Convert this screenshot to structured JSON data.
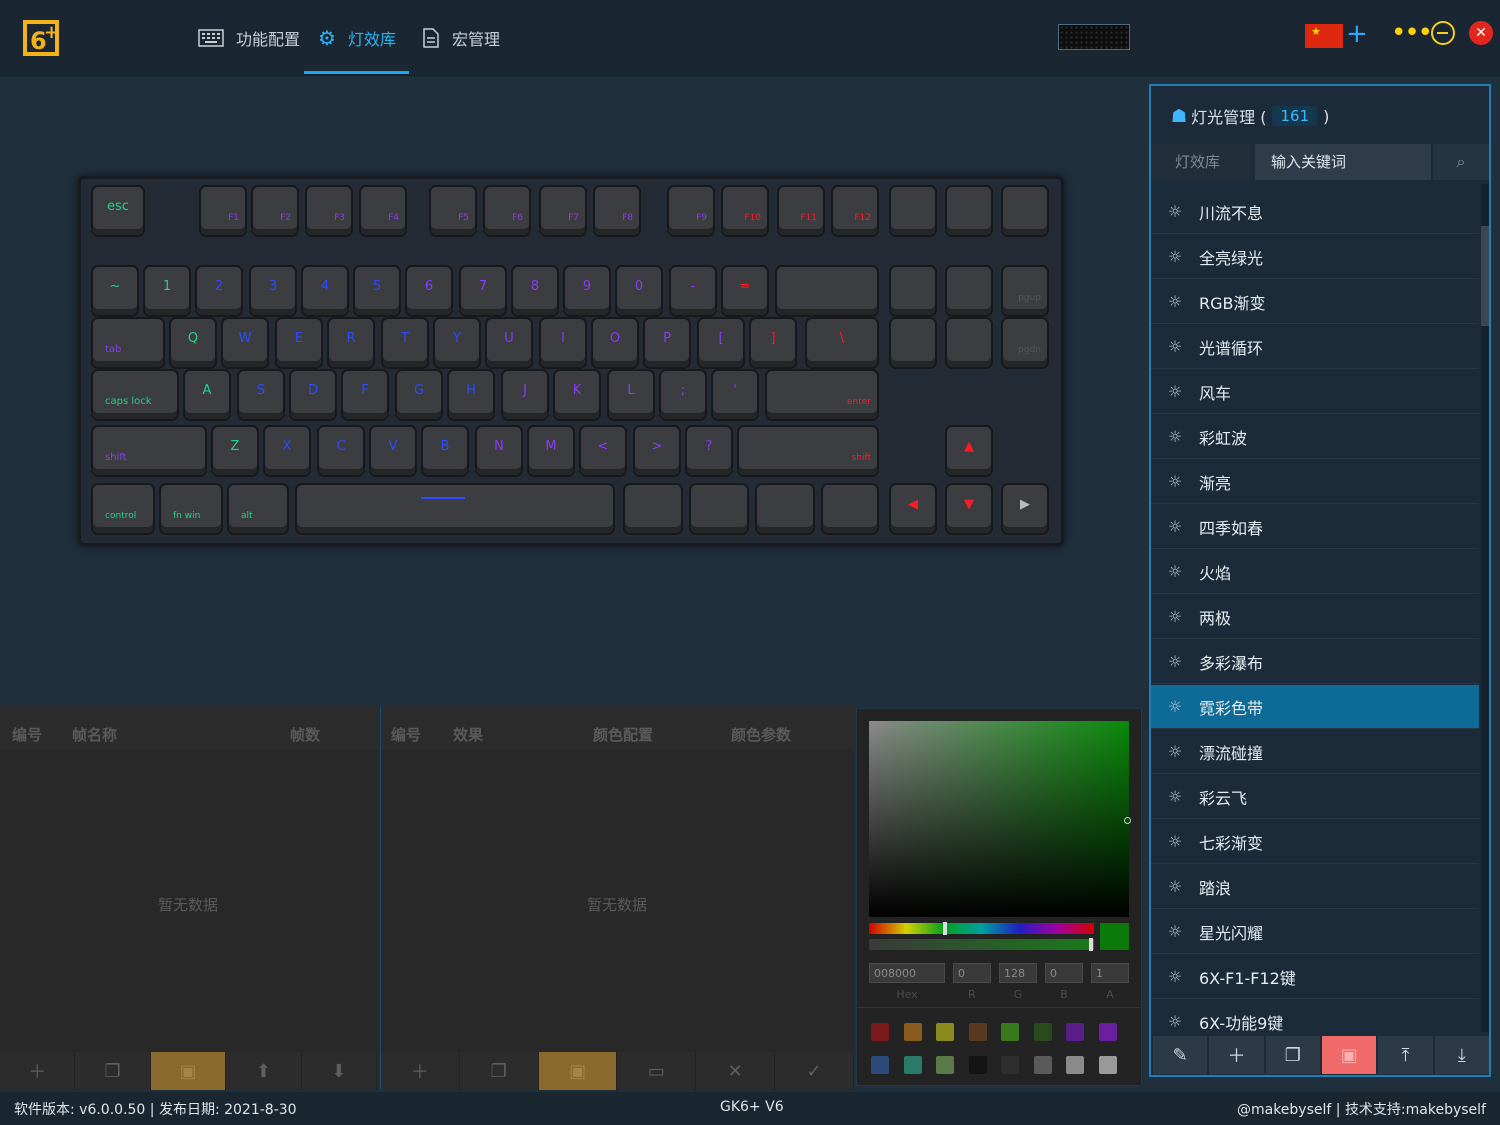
{
  "header": {
    "nav": [
      {
        "label": "功能配置",
        "icon": "keyboard-icon"
      },
      {
        "label": "灯效库",
        "icon": "gear-light-icon"
      },
      {
        "label": "宏管理",
        "icon": "document-icon"
      }
    ],
    "active_tab": "灯效库",
    "language_flag": "china-flag",
    "accent": "#2bb3f3"
  },
  "keyboard": {
    "row_fn": [
      "esc",
      "F1",
      "F2",
      "F3",
      "F4",
      "F5",
      "F6",
      "F7",
      "F8",
      "F9",
      "F10",
      "F11",
      "F12"
    ],
    "row_num": [
      "~",
      "1",
      "2",
      "3",
      "4",
      "5",
      "6",
      "7",
      "8",
      "9",
      "0",
      "-",
      "="
    ],
    "row_q": [
      "tab",
      "Q",
      "W",
      "E",
      "R",
      "T",
      "Y",
      "U",
      "I",
      "O",
      "P",
      "[",
      "]",
      "\\"
    ],
    "row_a": [
      "caps lock",
      "A",
      "S",
      "D",
      "F",
      "G",
      "H",
      "J",
      "K",
      "L",
      ";",
      "'",
      "enter"
    ],
    "row_z": [
      "shift",
      "Z",
      "X",
      "C",
      "V",
      "B",
      "N",
      "M",
      "<",
      ">",
      "?",
      "shift"
    ],
    "row_bottom": [
      "control",
      "fn win",
      "alt"
    ],
    "nav_keys": [
      "pgup",
      "pgdn"
    ]
  },
  "frames_panel": {
    "col_id": "编号",
    "col_name": "帧名称",
    "col_count": "帧数",
    "empty": "暂无数据"
  },
  "effects_panel": {
    "col_id": "编号",
    "col_effect": "效果",
    "col_color_cfg": "颜色配置",
    "col_color_param": "颜色参数",
    "empty": "暂无数据"
  },
  "color_picker": {
    "hex": "008000",
    "r": "0",
    "g": "128",
    "b": "0",
    "a": "1",
    "labels": {
      "hex": "Hex",
      "r": "R",
      "g": "G",
      "b": "B",
      "a": "A"
    },
    "swatches_row1": [
      "#7b1a1a",
      "#8a5a1e",
      "#8a8a1e",
      "#5a3a1e",
      "#3a7a1e",
      "#2a4a1e",
      "#5a1e8a",
      "#6a1ea0"
    ],
    "swatches_row2": [
      "#2a4a7a",
      "#2a7a6a",
      "#5a7a4a",
      "#141414",
      "#2e2e2e",
      "#5a5a5a",
      "#8a8a8a",
      "#9a9a9a"
    ]
  },
  "light_manager": {
    "title": "灯光管理 (",
    "title_close": ")",
    "count": "161",
    "tab": "灯效库",
    "search_placeholder": "输入关键词",
    "items": [
      "川流不息",
      "全亮绿光",
      "RGB渐变",
      "光谱循环",
      "风车",
      "彩虹波",
      "渐亮",
      "四季如春",
      "火焰",
      "两极",
      "多彩瀑布",
      "霓彩色带",
      "漂流碰撞",
      "彩云飞",
      "七彩渐变",
      "踏浪",
      "星光闪耀",
      "6X-F1-F12键",
      "6X-功能9键"
    ],
    "selected": "霓彩色带"
  },
  "status": {
    "version": "软件版本: v6.0.0.50 | 发布日期: 2021-8-30",
    "device": "GK6+ V6",
    "credit": "@makebyself | 技术支持:makebyself"
  }
}
